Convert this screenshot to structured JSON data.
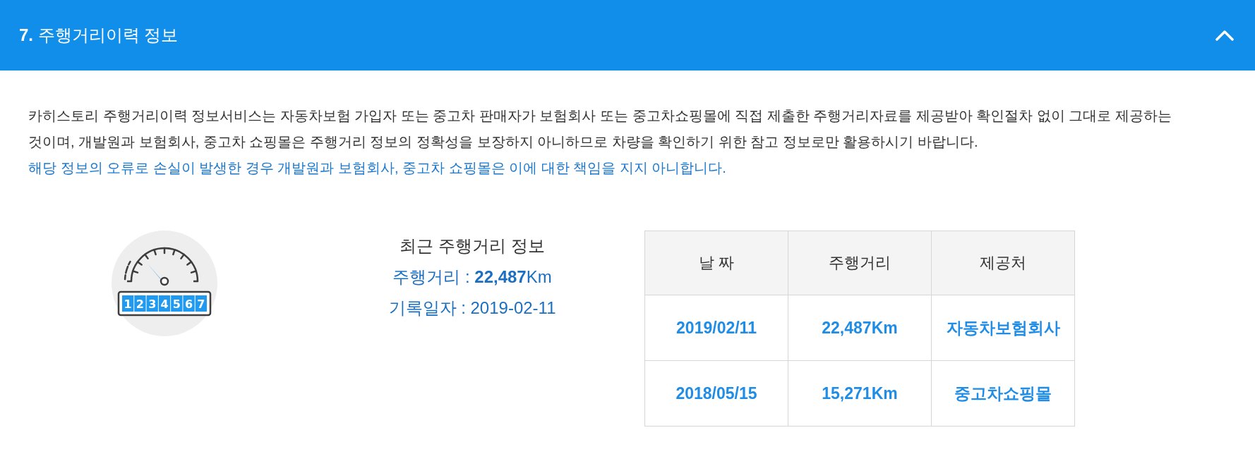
{
  "section": {
    "heading": "**7.** 주행거리이력 정보",
    "expanded": true
  },
  "notice": {
    "text": "카히스토리 주행거리이력 정보서비스는 자동차보험 가입자 또는 중고차 판매자가 보험회사 또는 중고차쇼핑몰에 직접 제출한 주행거리자료를 제공받아 확인절차 없이 그대로 제공하는 것이며, 개발원과 보험회사, 중고차 쇼핑몰은 주행거리 정보의 정확성을 보장하지 아니하므로 차량을 확인하기 위한 참고 정보로만 활용하시기 바랍니다.",
    "warning": "해당 정보의 오류로 손실이 발생한 경우 개발원과 보험회사, 중고차 쇼핑몰은 이에 대한 책임을 지지 아니합니다."
  },
  "odometer_digits": [
    "1",
    "2",
    "3",
    "4",
    "5",
    "6",
    "7"
  ],
  "recent": {
    "title": "최근 주행거리 정보",
    "lines": [
      "주행거리 : **22,487**Km",
      "기록일자 : 2019-02-11"
    ]
  },
  "table": {
    "columns": [
      "날 짜",
      "주행거리",
      "제공처"
    ],
    "rows": [
      [
        "2019/02/11",
        "22,487Km",
        "자동차보험회사"
      ],
      [
        "2018/05/15",
        "15,271Km",
        "중고차쇼핑몰"
      ]
    ]
  }
}
